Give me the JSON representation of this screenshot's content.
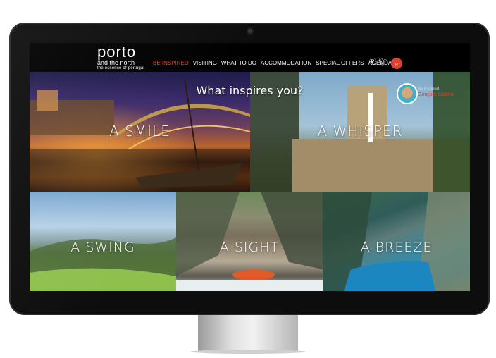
{
  "brand": {
    "name": "porto",
    "subtitle": "and the north",
    "tagline": "the essence of portugal"
  },
  "nav": {
    "items": [
      {
        "label": "BE INSPIRED",
        "active": true
      },
      {
        "label": "VISITING",
        "active": false
      },
      {
        "label": "WHAT TO DO",
        "active": false
      },
      {
        "label": "ACCOMMODATION",
        "active": false
      },
      {
        "label": "SPECIAL OFFERS",
        "active": false
      },
      {
        "label": "AGENDA",
        "active": false
      }
    ],
    "icons": [
      "pinterest-icon",
      "twitter-icon",
      "search-icon"
    ]
  },
  "hero": {
    "headline": "What inspires you?",
    "byline_prefix": "Be inspired",
    "byline_name": "Gonçalo Cadilhe"
  },
  "tiles": [
    {
      "label": "A SMILE"
    },
    {
      "label": "A WHISPER"
    },
    {
      "label": "A SWING"
    },
    {
      "label": "A SIGHT"
    },
    {
      "label": "A BREEZE"
    }
  ],
  "colors": {
    "accent": "#e0412f",
    "nav_background": "#000000",
    "text": "#ffffff"
  }
}
